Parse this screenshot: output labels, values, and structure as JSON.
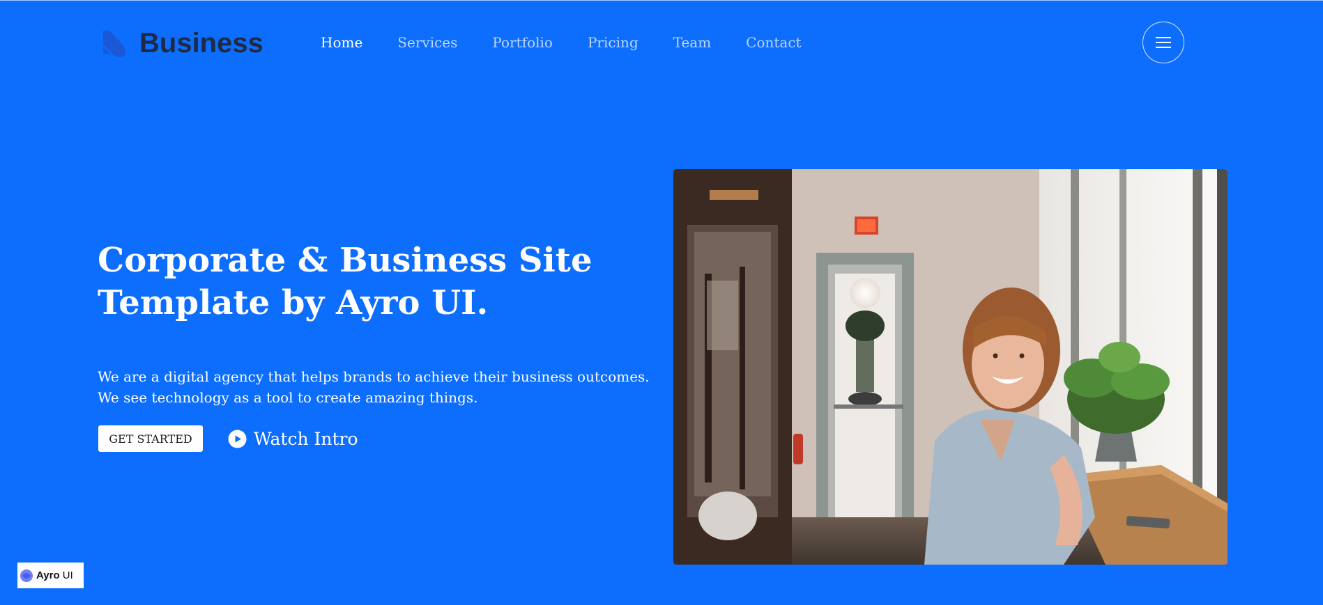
{
  "brand": {
    "name": "Business"
  },
  "nav": {
    "items": [
      {
        "label": "Home",
        "active": true
      },
      {
        "label": "Services",
        "active": false
      },
      {
        "label": "Portfolio",
        "active": false
      },
      {
        "label": "Pricing",
        "active": false
      },
      {
        "label": "Team",
        "active": false
      },
      {
        "label": "Contact",
        "active": false
      }
    ],
    "menu_icon": "hamburger-icon"
  },
  "hero": {
    "title_line1": "Corporate & Business Site",
    "title_line2": "Template by Ayro UI.",
    "desc_line1": "We are a digital agency that helps brands to achieve their business outcomes.",
    "desc_line2": "We see technology as a tool to create amazing things.",
    "cta_label": "GET STARTED",
    "watch_label": "Watch Intro",
    "watch_icon": "play-icon"
  },
  "badge": {
    "bold": "Ayro",
    "rest": " UI"
  },
  "colors": {
    "background": "#0d6efd",
    "logo_text": "#1f2a44",
    "logo_mark": "#1a58d6",
    "nav_inactive": "rgba(255,255,255,0.72)",
    "white": "#ffffff"
  }
}
